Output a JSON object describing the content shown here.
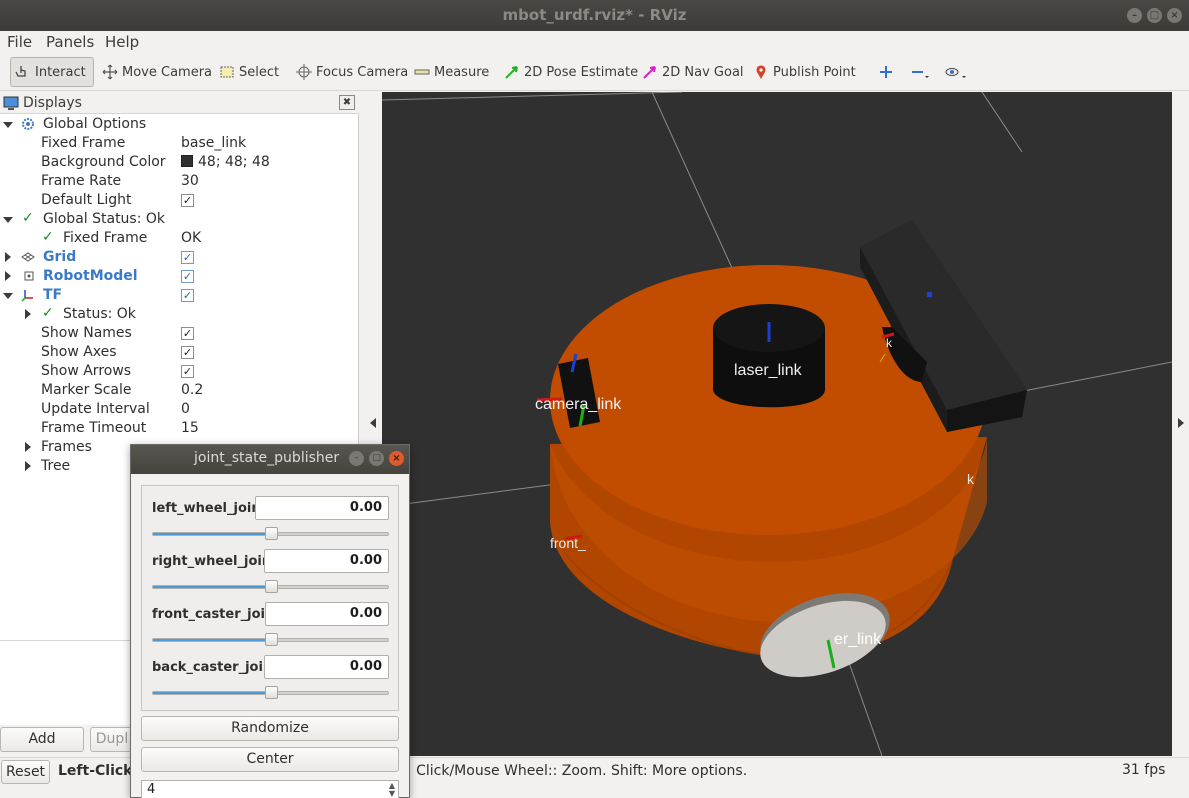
{
  "window": {
    "title": "mbot_urdf.rviz* - RViz"
  },
  "menu": {
    "items": [
      "File",
      "Panels",
      "Help"
    ]
  },
  "toolbar": {
    "tools": [
      {
        "label": "Interact",
        "icon": "hand-pointer-icon",
        "active": true
      },
      {
        "label": "Move Camera",
        "icon": "move-camera-icon"
      },
      {
        "label": "Select",
        "icon": "select-rectangle-icon"
      },
      {
        "label": "Focus Camera",
        "icon": "focus-crosshair-icon"
      },
      {
        "label": "Measure",
        "icon": "ruler-icon"
      },
      {
        "label": "2D Pose Estimate",
        "icon": "green-arrow-icon"
      },
      {
        "label": "2D Nav Goal",
        "icon": "magenta-arrow-icon"
      },
      {
        "label": "Publish Point",
        "icon": "map-pin-icon"
      }
    ]
  },
  "displays": {
    "title": "Displays",
    "global_options": {
      "label": "Global Options",
      "fixed_frame_label": "Fixed Frame",
      "fixed_frame": "base_link",
      "background_color_label": "Background Color",
      "background_color": "48; 48; 48",
      "frame_rate_label": "Frame Rate",
      "frame_rate": "30",
      "default_light_label": "Default Light"
    },
    "global_status": {
      "label": "Global Status: Ok",
      "fixed_frame_label": "Fixed Frame",
      "fixed_frame_value": "OK"
    },
    "grid": "Grid",
    "robot_model": "RobotModel",
    "tf": {
      "label": "TF",
      "status": "Status: Ok",
      "show_names": "Show Names",
      "show_axes": "Show Axes",
      "show_arrows": "Show Arrows",
      "marker_scale_label": "Marker Scale",
      "marker_scale": "0.2",
      "update_interval_label": "Update Interval",
      "update_interval": "0",
      "frame_timeout_label": "Frame Timeout",
      "frame_timeout": "15",
      "frames": "Frames",
      "tree": "Tree"
    },
    "add_button": "Add",
    "duplicate_button": "Dupl",
    "reset_button": "Reset"
  },
  "status_bar": {
    "left_clicks": "Left-Click:",
    "message_rest": "Click/Mouse Wheel:: Zoom. Shift: More options.",
    "fps": "31 fps"
  },
  "viewport": {
    "labels": [
      "laser_link",
      "camera_link",
      "front_",
      "er_link",
      "k",
      "k"
    ],
    "background": "#303030",
    "robot_color": "#c45000"
  },
  "joint_state_publisher": {
    "title": "joint_state_publisher",
    "joints": [
      {
        "name": "left_wheel_joint",
        "value": "0.00",
        "fraction": 0.5
      },
      {
        "name": "right_wheel_joint",
        "value": "0.00",
        "fraction": 0.5
      },
      {
        "name": "front_caster_joint",
        "value": "0.00",
        "fraction": 0.5
      },
      {
        "name": "back_caster_joint",
        "value": "0.00",
        "fraction": 0.5
      }
    ],
    "randomize": "Randomize",
    "center": "Center",
    "spin_value": "4"
  }
}
